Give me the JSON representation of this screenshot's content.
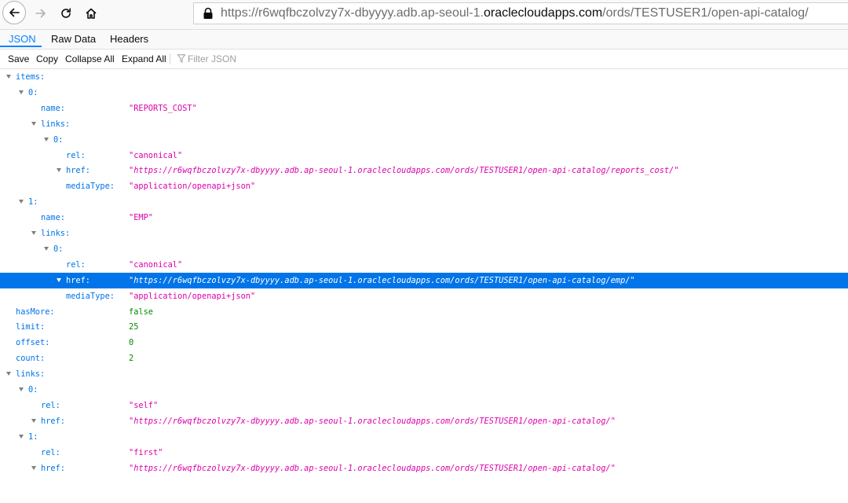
{
  "browser": {
    "url_prefix": "https://r6wqfbczolvzy7x-dbyyyy.adb.ap-seoul-1.",
    "url_domain": "oraclecloudapps.com",
    "url_suffix": "/ords/TESTUSER1/open-api-catalog/"
  },
  "tabs": [
    {
      "label": "JSON",
      "selected": true
    },
    {
      "label": "Raw Data",
      "selected": false
    },
    {
      "label": "Headers",
      "selected": false
    }
  ],
  "toolbar": {
    "save": "Save",
    "copy": "Copy",
    "collapse_all": "Collapse All",
    "expand_all": "Expand All",
    "filter_placeholder": "Filter JSON"
  },
  "tree": [
    {
      "key": "items:",
      "depth": 0,
      "twisty": true
    },
    {
      "key": "0:",
      "depth": 1,
      "twisty": true
    },
    {
      "key": "name:",
      "depth": 2,
      "value": "\"REPORTS_COST\"",
      "type": "string"
    },
    {
      "key": "links:",
      "depth": 2,
      "twisty": true
    },
    {
      "key": "0:",
      "depth": 3,
      "twisty": true
    },
    {
      "key": "rel:",
      "depth": 4,
      "value": "\"canonical\"",
      "type": "string"
    },
    {
      "key": "href:",
      "depth": 4,
      "twisty": true,
      "value": "\"https://r6wqfbczolvzy7x-dbyyyy.adb.ap-seoul-1.oraclecloudapps.com/ords/TESTUSER1/open-api-catalog/reports_cost/\"",
      "type": "url"
    },
    {
      "key": "mediaType:",
      "depth": 4,
      "value": "\"application/openapi+json\"",
      "type": "string"
    },
    {
      "key": "1:",
      "depth": 1,
      "twisty": true
    },
    {
      "key": "name:",
      "depth": 2,
      "value": "\"EMP\"",
      "type": "string"
    },
    {
      "key": "links:",
      "depth": 2,
      "twisty": true
    },
    {
      "key": "0:",
      "depth": 3,
      "twisty": true
    },
    {
      "key": "rel:",
      "depth": 4,
      "value": "\"canonical\"",
      "type": "string"
    },
    {
      "key": "href:",
      "depth": 4,
      "twisty": true,
      "selected": true,
      "value": "\"https://r6wqfbczolvzy7x-dbyyyy.adb.ap-seoul-1.oraclecloudapps.com/ords/TESTUSER1/open-api-catalog/emp/\"",
      "type": "url"
    },
    {
      "key": "mediaType:",
      "depth": 4,
      "value": "\"application/openapi+json\"",
      "type": "string"
    },
    {
      "key": "hasMore:",
      "depth": 0,
      "value": "false",
      "type": "bool"
    },
    {
      "key": "limit:",
      "depth": 0,
      "value": "25",
      "type": "number"
    },
    {
      "key": "offset:",
      "depth": 0,
      "value": "0",
      "type": "number"
    },
    {
      "key": "count:",
      "depth": 0,
      "value": "2",
      "type": "number"
    },
    {
      "key": "links:",
      "depth": 0,
      "twisty": true
    },
    {
      "key": "0:",
      "depth": 1,
      "twisty": true
    },
    {
      "key": "rel:",
      "depth": 2,
      "value": "\"self\"",
      "type": "string"
    },
    {
      "key": "href:",
      "depth": 2,
      "twisty": true,
      "value": "\"https://r6wqfbczolvzy7x-dbyyyy.adb.ap-seoul-1.oraclecloudapps.com/ords/TESTUSER1/open-api-catalog/\"",
      "type": "url"
    },
    {
      "key": "1:",
      "depth": 1,
      "twisty": true
    },
    {
      "key": "rel:",
      "depth": 2,
      "value": "\"first\"",
      "type": "string"
    },
    {
      "key": "href:",
      "depth": 2,
      "twisty": true,
      "value": "\"https://r6wqfbczolvzy7x-dbyyyy.adb.ap-seoul-1.oraclecloudapps.com/ords/TESTUSER1/open-api-catalog/\"",
      "type": "url"
    }
  ]
}
